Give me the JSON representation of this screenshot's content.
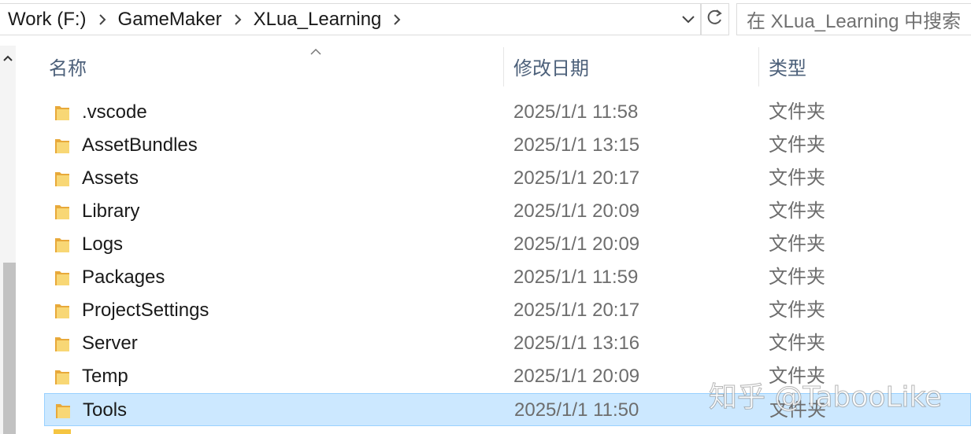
{
  "address_bar": {
    "crumbs": [
      "Work (F:)",
      "GameMaker",
      "XLua_Learning"
    ]
  },
  "search": {
    "placeholder": "在 XLua_Learning 中搜索"
  },
  "columns": {
    "name": "名称",
    "date": "修改日期",
    "type": "类型"
  },
  "files": [
    {
      "name": ".vscode",
      "date": "2025/1/1 11:58",
      "type": "文件夹"
    },
    {
      "name": "AssetBundles",
      "date": "2025/1/1 13:15",
      "type": "文件夹"
    },
    {
      "name": "Assets",
      "date": "2025/1/1 20:17",
      "type": "文件夹"
    },
    {
      "name": "Library",
      "date": "2025/1/1 20:09",
      "type": "文件夹"
    },
    {
      "name": "Logs",
      "date": "2025/1/1 20:09",
      "type": "文件夹"
    },
    {
      "name": "Packages",
      "date": "2025/1/1 11:59",
      "type": "文件夹"
    },
    {
      "name": "ProjectSettings",
      "date": "2025/1/1 20:17",
      "type": "文件夹"
    },
    {
      "name": "Server",
      "date": "2025/1/1 13:16",
      "type": "文件夹"
    },
    {
      "name": "Temp",
      "date": "2025/1/1 20:09",
      "type": "文件夹"
    },
    {
      "name": "Tools",
      "date": "2025/1/1 11:50",
      "type": "文件夹",
      "selected": true
    }
  ],
  "watermark": "知乎 @TabooLike",
  "colors": {
    "selection": "#cce8ff",
    "selection_border": "#99d1ff",
    "folder": "#f5c542",
    "header_text": "#4c607a"
  },
  "icons": [
    "folder-icon",
    "chevron-right-icon",
    "chevron-down-icon",
    "refresh-icon",
    "sort-up-icon",
    "scroll-up-icon"
  ]
}
